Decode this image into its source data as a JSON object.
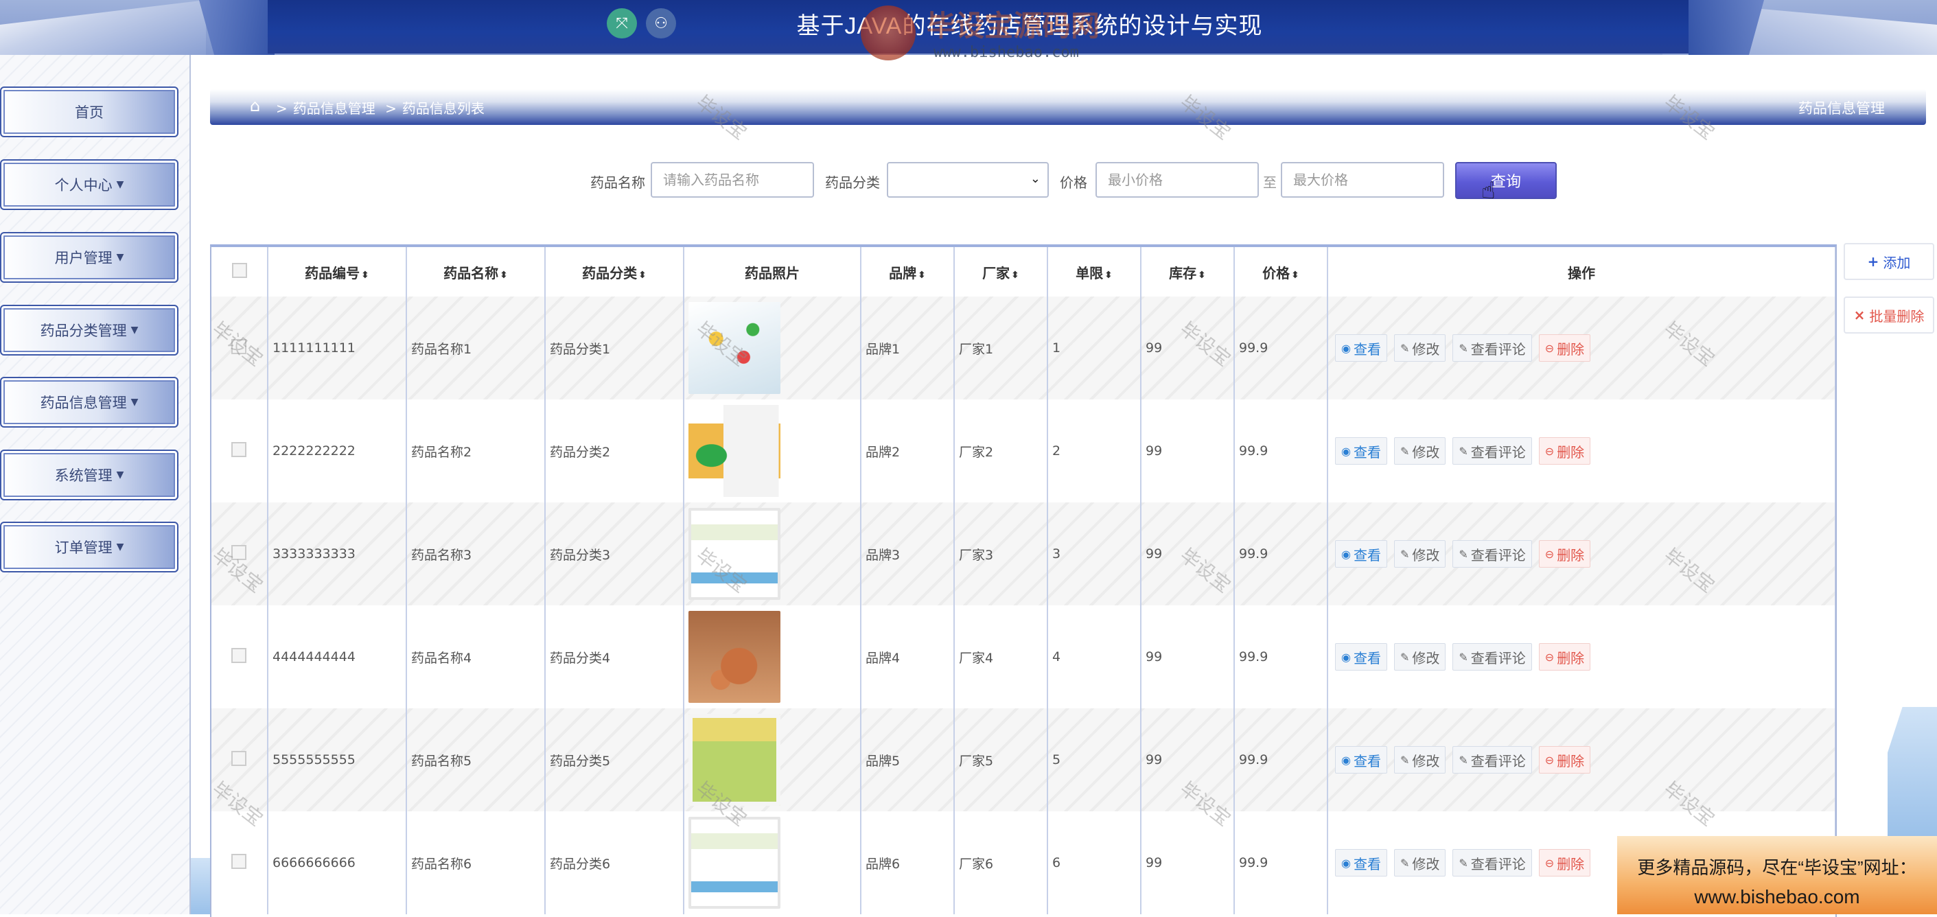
{
  "header": {
    "title": "基于JAVA的在线药店管理系统的设计与实现",
    "watermark_brand": "毕设宝源码网",
    "watermark_url": "www.bishebao.com"
  },
  "sidebar": {
    "items": [
      {
        "label": "首页",
        "dropdown": false
      },
      {
        "label": "个人中心",
        "dropdown": true
      },
      {
        "label": "用户管理",
        "dropdown": true
      },
      {
        "label": "药品分类管理",
        "dropdown": true
      },
      {
        "label": "药品信息管理",
        "dropdown": true
      },
      {
        "label": "系统管理",
        "dropdown": true
      },
      {
        "label": "订单管理",
        "dropdown": true
      }
    ]
  },
  "breadcrumb": {
    "path": [
      "药品信息管理",
      "药品信息列表"
    ],
    "page_name": "药品信息管理"
  },
  "search": {
    "name_label": "药品名称",
    "name_placeholder": "请输入药品名称",
    "category_label": "药品分类",
    "price_label": "价格",
    "min_placeholder": "最小价格",
    "to_label": "至",
    "max_placeholder": "最大价格",
    "query_button": "查询"
  },
  "actions": {
    "add": "添加",
    "batch_delete": "批量删除"
  },
  "table": {
    "headers": {
      "code": "药品编号",
      "name": "药品名称",
      "category": "药品分类",
      "photo": "药品照片",
      "brand": "品牌",
      "maker": "厂家",
      "limit": "单限",
      "stock": "库存",
      "price": "价格",
      "ops": "操作"
    },
    "op_labels": {
      "view": "查看",
      "edit": "修改",
      "review": "查看评论",
      "delete": "删除"
    },
    "rows": [
      {
        "code": "1111111111",
        "name": "药品名称1",
        "category": "药品分类1",
        "brand": "品牌1",
        "maker": "厂家1",
        "limit": "1",
        "stock": "99",
        "price": "99.9",
        "photo_icon": "pills-photo"
      },
      {
        "code": "2222222222",
        "name": "药品名称2",
        "category": "药品分类2",
        "brand": "品牌2",
        "maker": "厂家2",
        "limit": "2",
        "stock": "99",
        "price": "99.9",
        "photo_icon": "bottle-box-photo"
      },
      {
        "code": "3333333333",
        "name": "药品名称3",
        "category": "药品分类3",
        "brand": "品牌3",
        "maker": "厂家3",
        "limit": "3",
        "stock": "99",
        "price": "99.9",
        "photo_icon": "capsule-box-photo"
      },
      {
        "code": "4444444444",
        "name": "药品名称4",
        "category": "药品分类4",
        "brand": "品牌4",
        "maker": "厂家4",
        "limit": "4",
        "stock": "99",
        "price": "99.9",
        "photo_icon": "pellets-photo"
      },
      {
        "code": "5555555555",
        "name": "药品名称5",
        "category": "药品分类5",
        "brand": "品牌5",
        "maker": "厂家5",
        "limit": "5",
        "stock": "99",
        "price": "99.9",
        "photo_icon": "herbal-box-photo"
      },
      {
        "code": "6666666666",
        "name": "药品名称6",
        "category": "药品分类6",
        "brand": "品牌6",
        "maker": "厂家6",
        "limit": "6",
        "stock": "99",
        "price": "99.9",
        "photo_icon": "capsule-box-photo"
      }
    ]
  },
  "watermark_text": "毕设宝",
  "ad_banner": {
    "line1": "更多精品源码，尽在“毕设宝”网址：",
    "line2": "www.bishebao.com"
  },
  "colors": {
    "header_blue": "#1b3e9e",
    "query_button": "#5c5ad6",
    "view_link": "#2a7fd4",
    "delete_red": "#e2574c"
  }
}
